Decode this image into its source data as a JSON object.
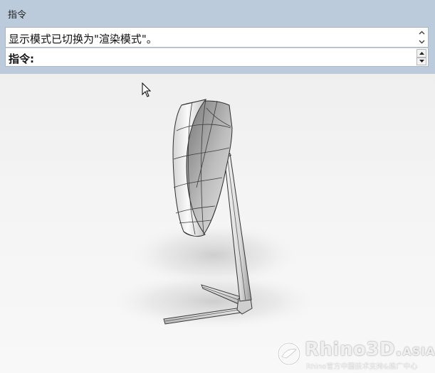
{
  "command_panel": {
    "title": "指令",
    "history_text": "显示模式已切换为\"渲染模式\"。",
    "prompt_label": "指令:",
    "prompt_value": ""
  },
  "viewport": {
    "display_mode": "渲染模式",
    "background_color": "#f2f2f2"
  },
  "watermark": {
    "brand": "Rhino3D.",
    "brand_suffix": "ASIA",
    "subtitle": "Rhino官方中国技术支持&推广中心"
  },
  "colors": {
    "panel_background": "#bccbdc",
    "field_background": "#ffffff",
    "text": "#111111"
  }
}
